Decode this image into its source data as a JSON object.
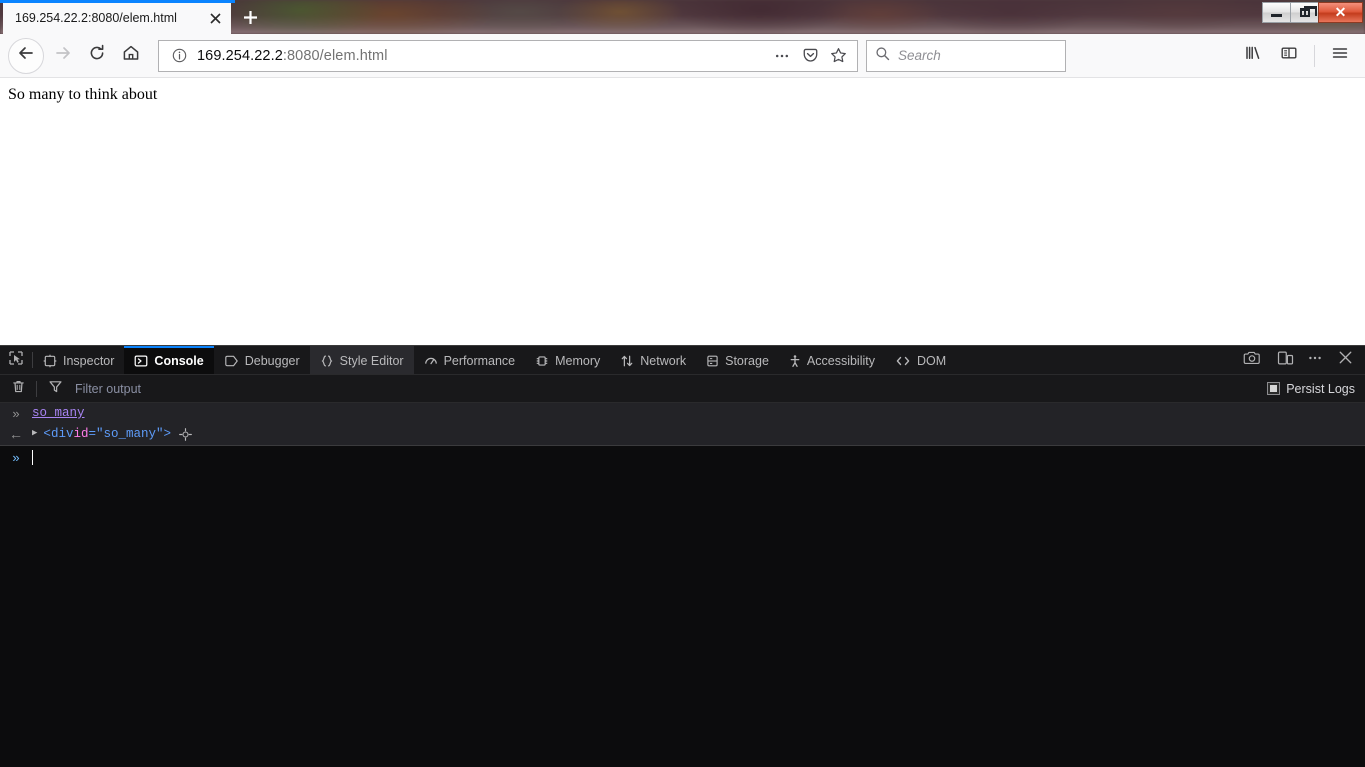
{
  "window": {
    "controls": [
      {
        "name": "minimize",
        "glyph": "minimize-icon"
      },
      {
        "name": "restore",
        "glyph": "restore-icon"
      },
      {
        "name": "close",
        "glyph": "close-icon",
        "label": "✕",
        "color": "#c33c1d"
      }
    ]
  },
  "tabstrip": {
    "tabs": [
      {
        "title": "169.254.22.2:8080/elem.html",
        "active": true,
        "close_label": "✕"
      }
    ],
    "new_tab_label": "+",
    "accent": "#0a84ff"
  },
  "navbar": {
    "back_label": "back-arrow",
    "forward_label": "forward-arrow",
    "reload_label": "reload",
    "home_label": "home",
    "url": {
      "host": "169.254.22.2",
      "rest": ":8080/elem.html",
      "full": "169.254.22.2:8080/elem.html",
      "identity_icon": "info-circle-icon"
    },
    "page_actions_label": "•••",
    "pocket_label": "save-to-pocket",
    "bookmark_label": "bookmark-star",
    "search": {
      "placeholder": "Search",
      "icon": "search-icon"
    },
    "library_label": "library",
    "sidebar_label": "sidebars",
    "menu_label": "open-menu"
  },
  "page": {
    "body_text": "So many to think about"
  },
  "devtools": {
    "picker_label": "element-picker",
    "tabs": [
      {
        "label": "Inspector",
        "icon": "inspector-icon",
        "state": "normal"
      },
      {
        "label": "Console",
        "icon": "console-icon",
        "state": "active"
      },
      {
        "label": "Debugger",
        "icon": "debugger-icon",
        "state": "normal"
      },
      {
        "label": "Style Editor",
        "icon": "style-editor-icon",
        "state": "hover"
      },
      {
        "label": "Performance",
        "icon": "performance-icon",
        "state": "normal"
      },
      {
        "label": "Memory",
        "icon": "memory-icon",
        "state": "normal"
      },
      {
        "label": "Network",
        "icon": "network-icon",
        "state": "normal"
      },
      {
        "label": "Storage",
        "icon": "storage-icon",
        "state": "normal"
      },
      {
        "label": "Accessibility",
        "icon": "accessibility-icon",
        "state": "normal"
      },
      {
        "label": "DOM",
        "icon": "dom-icon",
        "state": "normal"
      }
    ],
    "toolbar_right": [
      {
        "name": "screenshot",
        "label": "camera-icon"
      },
      {
        "name": "responsive-design-mode",
        "label": "responsive-icon"
      },
      {
        "name": "devtools-meatball-menu",
        "label": "•••"
      },
      {
        "name": "close-devtools",
        "label": "✕"
      }
    ],
    "console": {
      "clear_label": "trash-icon",
      "filter_icon": "funnel-icon",
      "filter_placeholder": "Filter output",
      "persist_logs_label": "Persist Logs",
      "persist_logs_checked": false,
      "rows": [
        {
          "type": "input",
          "gutter": "»",
          "expression": "so_many"
        },
        {
          "type": "result",
          "gutter": "←",
          "twisty": "▶",
          "node": {
            "open": "<",
            "tag": "div",
            "space": " ",
            "attr": "id",
            "eq": "=",
            "value": "\"so_many\"",
            "close": ">"
          },
          "target_icon": "inspect-node-icon"
        }
      ],
      "prompt": {
        "chevron": "»",
        "value": ""
      }
    }
  },
  "colors": {
    "accent_blue": "#0a84ff",
    "devtools_bg": "#0c0c0d",
    "devtools_toolbar_bg": "#18181a",
    "console_row_bg": "#232327",
    "identifier_purple": "#a884f3",
    "tag_blue": "#5e9cfa",
    "attr_pink": "#ff7de9"
  }
}
